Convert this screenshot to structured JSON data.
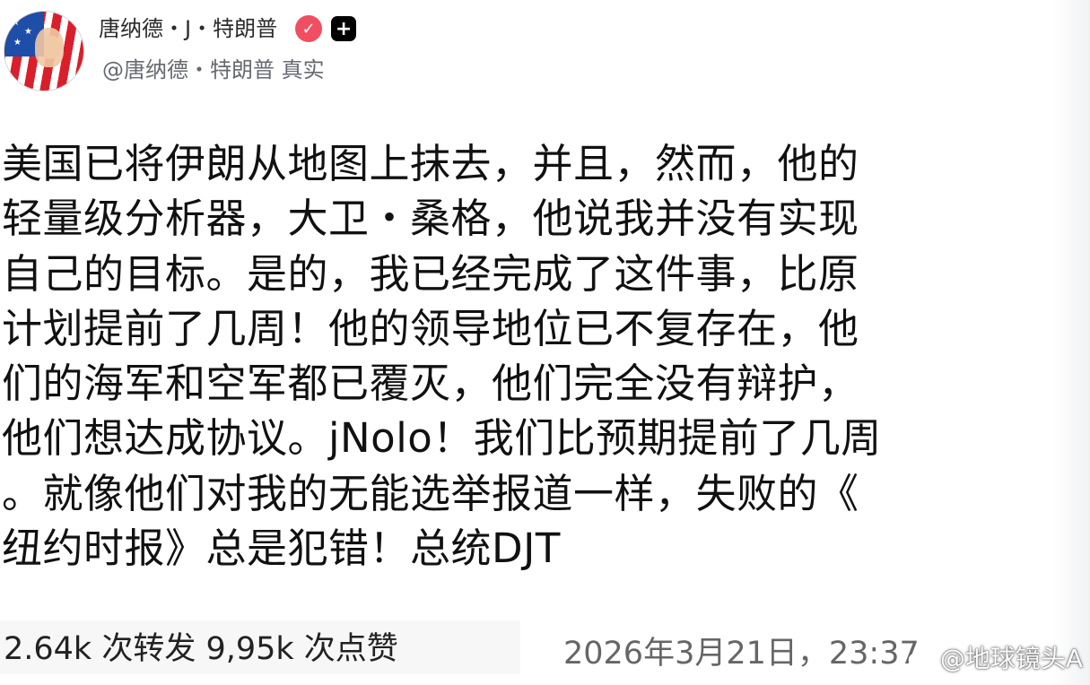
{
  "profile": {
    "display_name": "唐纳德・J・特朗普",
    "handle": "@唐纳德・特朗普 真实",
    "verified_icon": "checkmark-icon",
    "badge_icon": "plus-icon"
  },
  "post": {
    "lines": [
      "美国已将伊朗从地图上抹去，并且，然而，他的",
      "轻量级分析器，大卫・桑格，他说我并没有实现",
      "自己的目标。是的，我已经完成了这件事，比原",
      "计划提前了几周！他的领导地位已不复存在，他",
      "们的海军和空军都已覆灭，他们完全没有辩护，",
      "他们想达成协议。jNolo！我们比预期提前了几周",
      "。就像他们对我的无能选举报道一样，失败的《",
      "纽约时报》总是犯错！总统DJT"
    ]
  },
  "footer": {
    "stats": "2.64k 次转发 9,95k 次点赞",
    "timestamp": "2026年3月21日，23:37",
    "watermark": "@地球镜头A"
  },
  "colors": {
    "verified": "#ef4f61",
    "badge": "#000000",
    "text": "#111111",
    "muted": "#666a70"
  }
}
